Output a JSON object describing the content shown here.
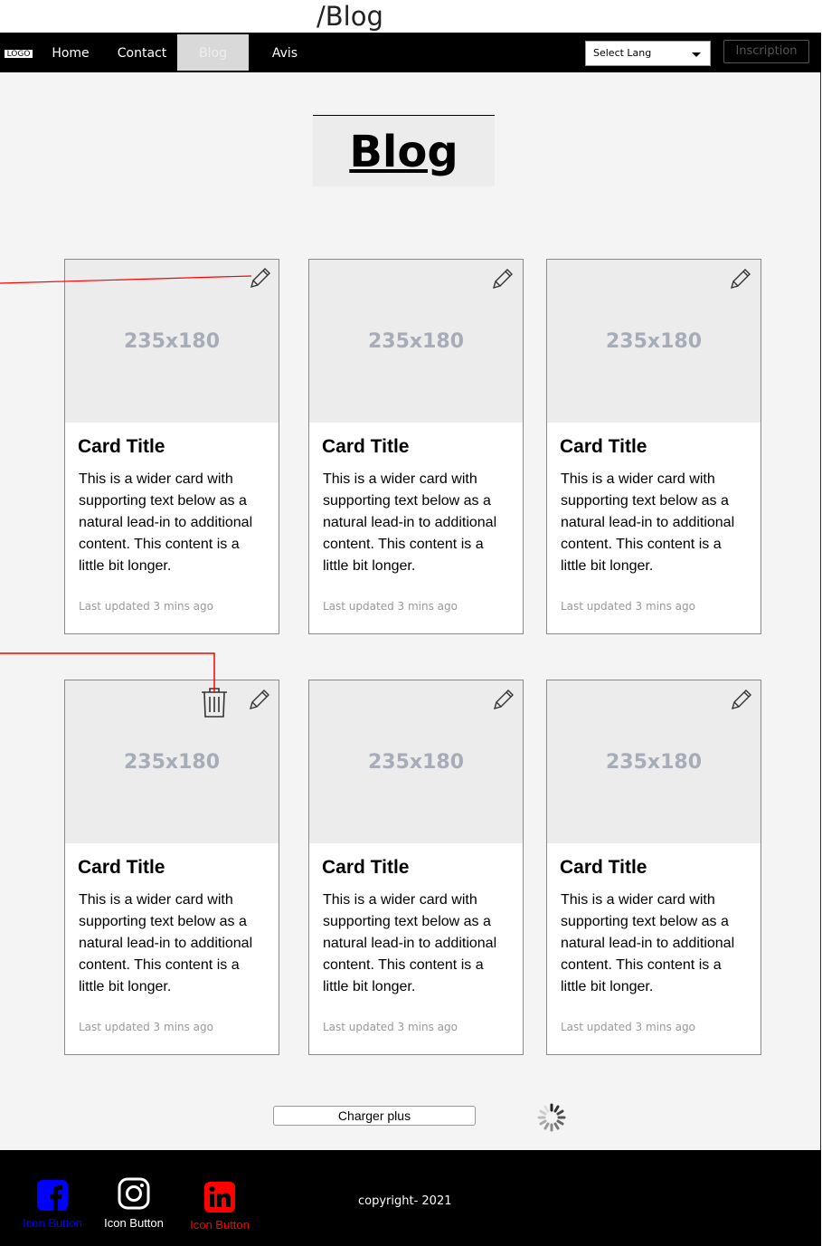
{
  "page_path": "/Blog",
  "nav": {
    "logo": "LOGO",
    "items": [
      {
        "label": "Home"
      },
      {
        "label": "Contact"
      },
      {
        "label": "Blog",
        "active": true
      },
      {
        "label": "Avis"
      }
    ],
    "lang_select": "Select Lang",
    "signup_label": "Inscription"
  },
  "page_title": "Blog",
  "cards": [
    {
      "image_label": "235x180",
      "title": "Card Title",
      "text": "This is a wider card with supporting text below as a natural lead-in to additional content. This content is a little bit longer.",
      "footer": "Last updated 3 mins ago"
    },
    {
      "image_label": "235x180",
      "title": "Card Title",
      "text": "This is a wider card with supporting text below as a natural lead-in to additional content. This content is a little bit longer.",
      "footer": "Last updated 3 mins ago"
    },
    {
      "image_label": "235x180",
      "title": "Card Title",
      "text": "This is a wider card with supporting text below as a natural lead-in to additional content. This content is a little bit longer.",
      "footer": "Last updated 3 mins ago"
    },
    {
      "image_label": "235x180",
      "title": "Card Title",
      "text": "This is a wider card with supporting text below as a natural lead-in to additional content. This content is a little bit longer.",
      "footer": "Last updated 3 mins ago"
    },
    {
      "image_label": "235x180",
      "title": "Card Title",
      "text": "This is a wider card with supporting text below as a natural lead-in to additional content. This content is a little bit longer.",
      "footer": "Last updated 3 mins ago"
    },
    {
      "image_label": "235x180",
      "title": "Card Title",
      "text": "This is a wider card with supporting text below as a natural lead-in to additional content. This content is a little bit longer.",
      "footer": "Last updated 3 mins ago"
    }
  ],
  "load_more_label": "Charger plus",
  "footer": {
    "social": [
      {
        "icon": "facebook-icon",
        "label": "Icon Button",
        "color": "#0000ff"
      },
      {
        "icon": "instagram-icon",
        "label": "Icon Button",
        "color": "#ffffff"
      },
      {
        "icon": "linkedin-icon",
        "label": "Icon Button",
        "color": "#ff0000"
      }
    ],
    "copyright": "copyright- 2021"
  },
  "colors": {
    "annotation_line": "#ff0000",
    "nav_bg": "#000000",
    "active_tab_bg": "#d9d9d9",
    "placeholder_text": "#a6adb9"
  }
}
